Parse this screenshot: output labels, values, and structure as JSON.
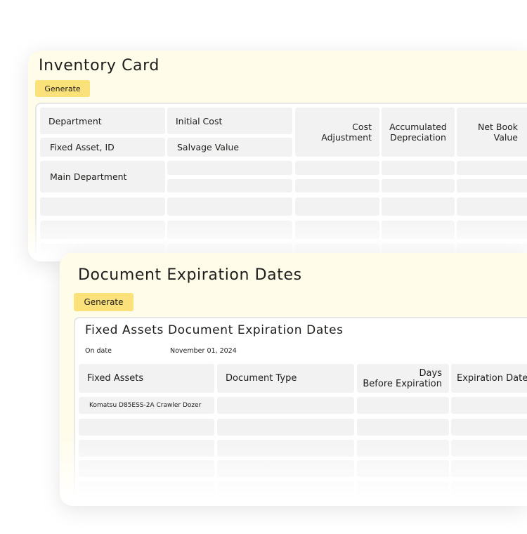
{
  "inventory": {
    "title": "Inventory Card",
    "generate_label": "Generate",
    "labels": {
      "department": "Department",
      "initial_cost": "Initial Cost",
      "cost_adjustment": "Cost\nAdjustment",
      "accumulated_depreciation": "Accumulated\nDepreciation",
      "net_book_value": "Net Book\nValue",
      "fixed_asset_id": "Fixed Asset, ID",
      "salvage_value": "Salvage Value",
      "main_department": "Main Department"
    }
  },
  "expiration": {
    "title": "Document Expiration Dates",
    "generate_label": "Generate",
    "report_title": "Fixed Assets Document Expiration Dates",
    "on_date_label": "On date",
    "on_date_value": "November 01, 2024",
    "columns": [
      "Fixed Assets",
      "Document Type",
      "Days\nBefore Expiration",
      "Expiration Date"
    ],
    "rows": [
      [
        "Komatsu D85ESS-2A Crawler Dozer",
        "",
        "",
        ""
      ]
    ]
  },
  "colors": {
    "panel_bg": "#fffce9",
    "button_bg": "#fbe17a",
    "cell_bg": "#f2f2f2"
  }
}
